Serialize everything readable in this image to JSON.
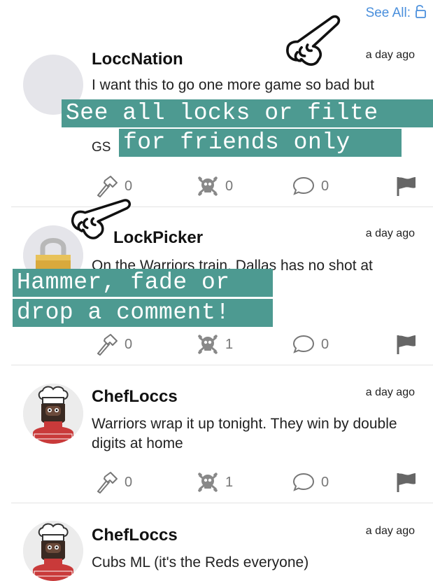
{
  "header": {
    "see_all_label": "See All:",
    "lock_icon": "unlock-icon"
  },
  "posts": [
    {
      "username": "LoccNation",
      "time": "a day ago",
      "text": "I want this to go one more game so bad but",
      "text_line2": "GS",
      "avatar": "placeholder",
      "hammer_count": "0",
      "fade_count": "0",
      "comment_count": "0"
    },
    {
      "username": "LockPicker",
      "time": "a day ago",
      "text": "On the Warriors train. Dallas has no shot at",
      "avatar": "padlock",
      "hammer_count": "0",
      "fade_count": "1",
      "comment_count": "0"
    },
    {
      "username": "ChefLoccs",
      "time": "a day ago",
      "text": "Warriors wrap it up tonight. They win by double digits at home",
      "avatar": "chef",
      "hammer_count": "0",
      "fade_count": "1",
      "comment_count": "0"
    },
    {
      "username": "ChefLoccs",
      "time": "a day ago",
      "text": "Cubs ML (it's the Reds everyone)",
      "avatar": "chef"
    }
  ],
  "overlays": {
    "locks_line1": "See all locks or filte",
    "locks_line2": "for friends only",
    "hammer_line1": "Hammer, fade or",
    "hammer_line2": "drop a comment!"
  },
  "colors": {
    "overlay_bg": "#4d9a91",
    "link": "#4a8fdc",
    "icon": "#777777"
  },
  "icons": [
    "hammer-icon",
    "skull-crossbones-icon",
    "comment-bubble-icon",
    "flag-icon",
    "pointing-hand-icon"
  ]
}
